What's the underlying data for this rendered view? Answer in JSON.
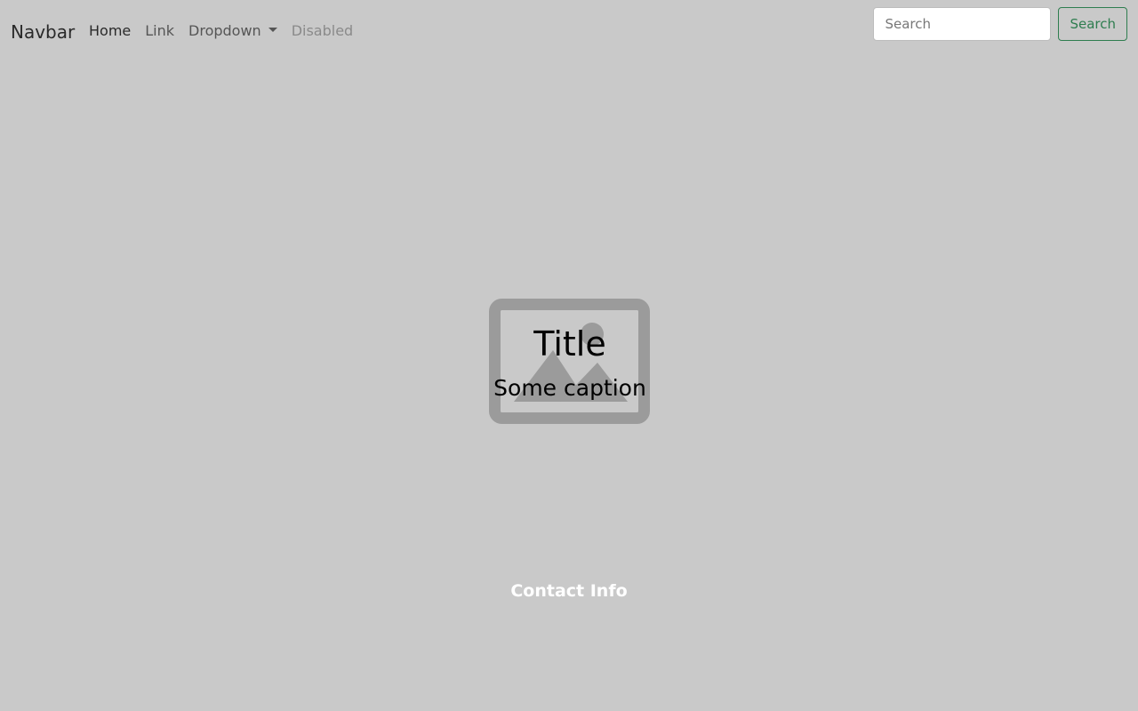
{
  "navbar": {
    "brand": "Navbar",
    "links": [
      {
        "label": "Home",
        "state": "active"
      },
      {
        "label": "Link",
        "state": "normal"
      },
      {
        "label": "Dropdown",
        "state": "dropdown"
      },
      {
        "label": "Disabled",
        "state": "disabled"
      }
    ],
    "search": {
      "placeholder": "Search",
      "value": "",
      "button_label": "Search"
    }
  },
  "hero": {
    "image_icon": "image-placeholder-icon",
    "title": "Title",
    "caption": "Some caption"
  },
  "footer": {
    "contact_label": "Contact Info"
  },
  "colors": {
    "background": "#c9c9c9",
    "accent": "#2e7d4f",
    "placeholder_icon": "#9b9b9b"
  }
}
